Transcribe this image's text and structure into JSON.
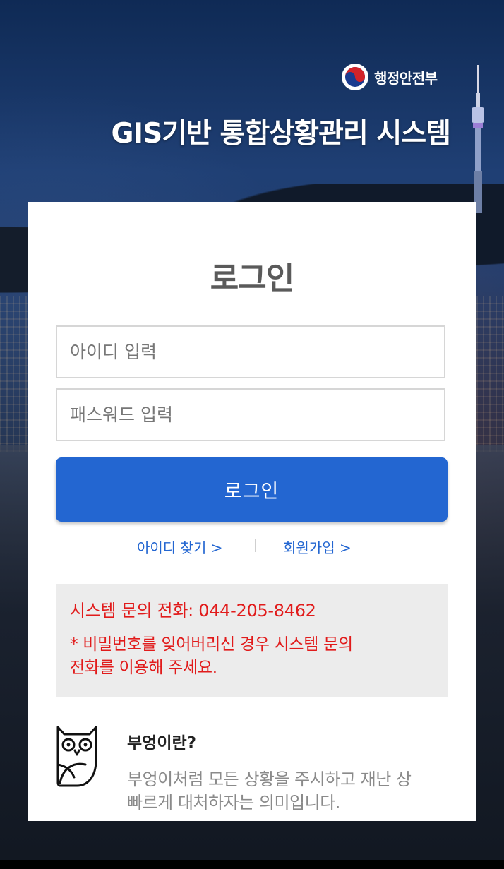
{
  "header": {
    "ministry_name": "행정안전부",
    "system_title": "GIS기반 통합상황관리 시스템",
    "emblem_icon": "taegeuk-emblem-icon"
  },
  "login": {
    "title": "로그인",
    "id_placeholder": "아이디 입력",
    "password_placeholder": "패스워드 입력",
    "submit_label": "로그인",
    "find_id_link": "아이디 찾기 >",
    "signup_link": "회원가입 >"
  },
  "notice": {
    "phone": "시스템 문의 전화: 044-205-8462",
    "note_line1": "* 비밀번호를 잊어버리신 경우 시스템 문의",
    "note_line2": "전화를 이용해 주세요."
  },
  "owl": {
    "icon": "owl-icon",
    "title": "부엉이란?",
    "desc_line1": "부엉이처럼 모든 상황을 주시하고 재난 상",
    "desc_line2": "빠르게 대처하자는 의미입니다."
  },
  "colors": {
    "primary": "#2366d1",
    "alert": "#e11b1b",
    "notice_bg": "#ececec"
  }
}
